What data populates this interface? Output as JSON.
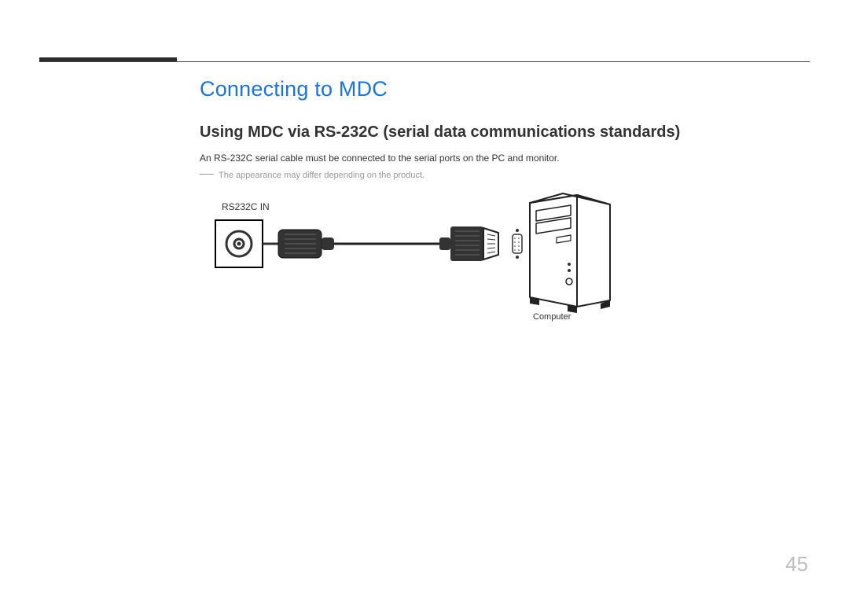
{
  "section_title": "Connecting to MDC",
  "subsection_title": "Using MDC via RS-232C (serial data communications standards)",
  "body": "An RS-232C serial cable must be connected to the serial ports on the PC and monitor.",
  "note": "The appearance may differ depending on the product.",
  "diagram": {
    "port_label": "RS232C IN",
    "device_label": "Computer"
  },
  "page_number": "45"
}
